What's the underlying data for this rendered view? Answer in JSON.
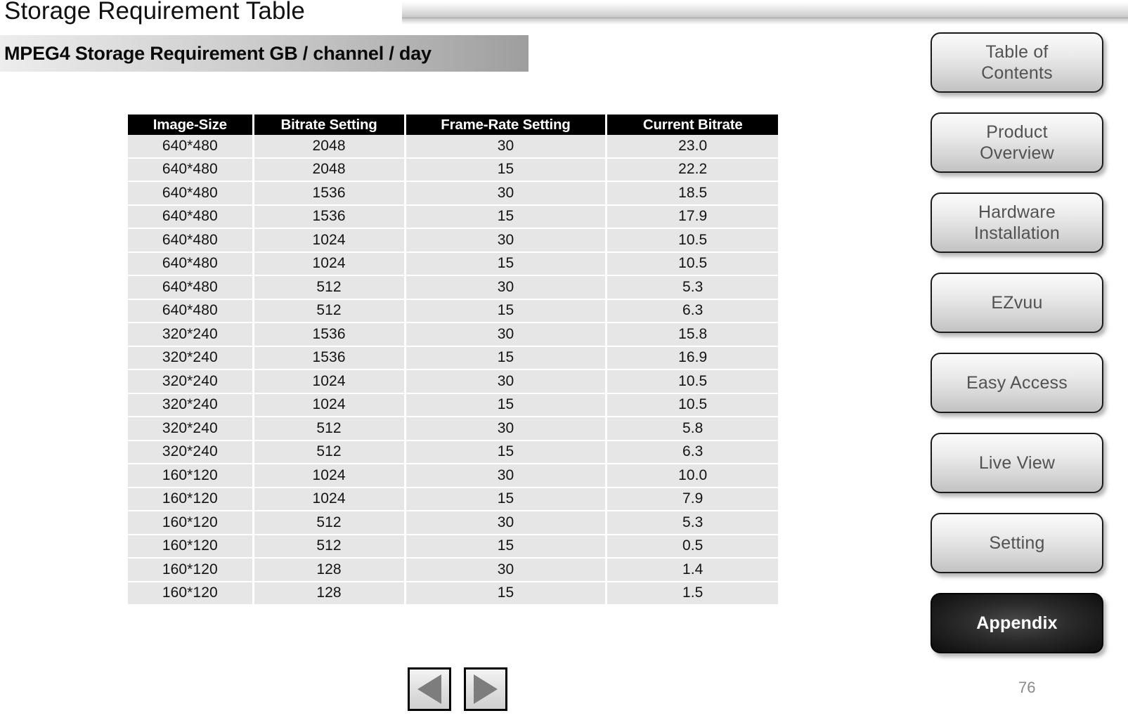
{
  "page_title": "Storage Requirement Table",
  "subtitle": "MPEG4 Storage Requirement GB / channel / day",
  "page_number": "76",
  "colors": {
    "header_bg": "#000000",
    "header_text": "#ffffff",
    "row_bg": "#e6e6e6",
    "active_button_bg": "#0d0d0d",
    "button_text": "#525252"
  },
  "table": {
    "columns": [
      "Image-Size",
      "Bitrate Setting",
      "Frame-Rate Setting",
      "Current Bitrate"
    ],
    "rows": [
      [
        "640*480",
        "2048",
        "30",
        "23.0"
      ],
      [
        "640*480",
        "2048",
        "15",
        "22.2"
      ],
      [
        "640*480",
        "1536",
        "30",
        "18.5"
      ],
      [
        "640*480",
        "1536",
        "15",
        "17.9"
      ],
      [
        "640*480",
        "1024",
        "30",
        "10.5"
      ],
      [
        "640*480",
        "1024",
        "15",
        "10.5"
      ],
      [
        "640*480",
        "512",
        "30",
        "5.3"
      ],
      [
        "640*480",
        "512",
        "15",
        "6.3"
      ],
      [
        "320*240",
        "1536",
        "30",
        "15.8"
      ],
      [
        "320*240",
        "1536",
        "15",
        "16.9"
      ],
      [
        "320*240",
        "1024",
        "30",
        "10.5"
      ],
      [
        "320*240",
        "1024",
        "15",
        "10.5"
      ],
      [
        "320*240",
        "512",
        "30",
        "5.8"
      ],
      [
        "320*240",
        "512",
        "15",
        "6.3"
      ],
      [
        "160*120",
        "1024",
        "30",
        "10.0"
      ],
      [
        "160*120",
        "1024",
        "15",
        "7.9"
      ],
      [
        "160*120",
        "512",
        "30",
        "5.3"
      ],
      [
        "160*120",
        "512",
        "15",
        "0.5"
      ],
      [
        "160*120",
        "128",
        "30",
        "1.4"
      ],
      [
        "160*120",
        "128",
        "15",
        "1.5"
      ]
    ]
  },
  "sidebar": {
    "items": [
      {
        "label": "Table of\nContents",
        "active": false
      },
      {
        "label": "Product\nOverview",
        "active": false
      },
      {
        "label": "Hardware\nInstallation",
        "active": false
      },
      {
        "label": "EZvuu",
        "active": false
      },
      {
        "label": "Easy Access",
        "active": false
      },
      {
        "label": "Live View",
        "active": false
      },
      {
        "label": "Setting",
        "active": false
      },
      {
        "label": "Appendix",
        "active": true
      }
    ]
  },
  "navigation": {
    "previous_icon": "triangle-left-icon",
    "next_icon": "triangle-right-icon",
    "previous_label": "Previous slide",
    "next_label": "Next slide"
  }
}
